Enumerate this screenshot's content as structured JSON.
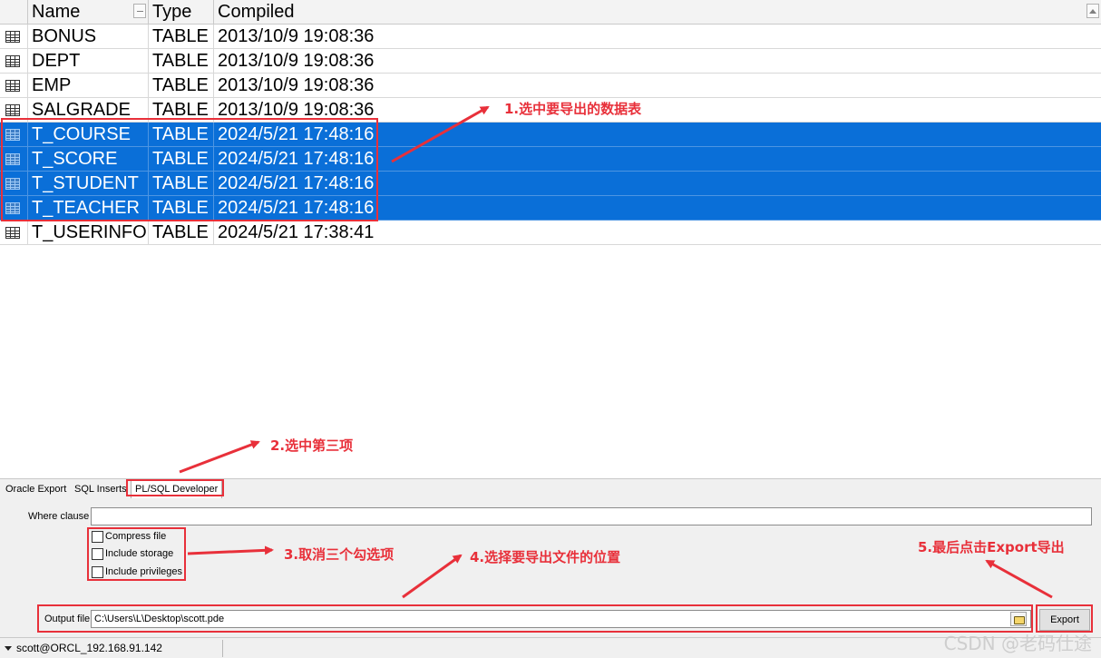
{
  "columns": {
    "name": "Name",
    "type": "Type",
    "compiled": "Compiled"
  },
  "rows": [
    {
      "name": "BONUS",
      "type": "TABLE",
      "compiled": "2013/10/9 19:08:36",
      "selected": false
    },
    {
      "name": "DEPT",
      "type": "TABLE",
      "compiled": "2013/10/9 19:08:36",
      "selected": false
    },
    {
      "name": "EMP",
      "type": "TABLE",
      "compiled": "2013/10/9 19:08:36",
      "selected": false
    },
    {
      "name": "SALGRADE",
      "type": "TABLE",
      "compiled": "2013/10/9 19:08:36",
      "selected": false
    },
    {
      "name": "T_COURSE",
      "type": "TABLE",
      "compiled": "2024/5/21 17:48:16",
      "selected": true
    },
    {
      "name": "T_SCORE",
      "type": "TABLE",
      "compiled": "2024/5/21 17:48:16",
      "selected": true
    },
    {
      "name": "T_STUDENT",
      "type": "TABLE",
      "compiled": "2024/5/21 17:48:16",
      "selected": true
    },
    {
      "name": "T_TEACHER",
      "type": "TABLE",
      "compiled": "2024/5/21 17:48:16",
      "selected": true
    },
    {
      "name": "T_USERINFO",
      "type": "TABLE",
      "compiled": "2024/5/21 17:38:41",
      "selected": false
    }
  ],
  "tabs": [
    {
      "label": "Oracle Export",
      "active": false
    },
    {
      "label": "SQL Inserts",
      "active": false
    },
    {
      "label": "PL/SQL Developer",
      "active": true
    }
  ],
  "form": {
    "where_label": "Where clause",
    "where_value": "",
    "options": [
      {
        "label": "Compress file",
        "checked": false
      },
      {
        "label": "Include storage",
        "checked": false
      },
      {
        "label": "Include privileges",
        "checked": false
      }
    ],
    "output_label": "Output file",
    "output_value": "C:\\Users\\L\\Desktop\\scott.pde",
    "export_label": "Export"
  },
  "annotations": {
    "step1": "1.选中要导出的数据表",
    "step2": "2.选中第三项",
    "step3": "3.取消三个勾选项",
    "step4": "4.选择要导出文件的位置",
    "step5": "5.最后点击Export导出"
  },
  "status": {
    "connection": "scott@ORCL_192.168.91.142"
  },
  "watermark": "CSDN @老码仕途",
  "colors": {
    "selection": "#0a6fd8",
    "annotation": "#e8303a"
  },
  "icons": {
    "row_icon": "table-icon",
    "folder": "folder-icon",
    "status_menu": "triangle-down-icon"
  }
}
